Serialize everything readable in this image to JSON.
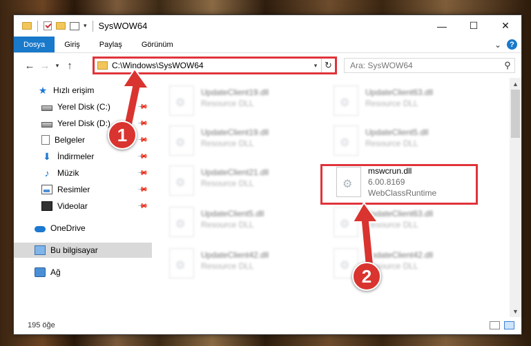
{
  "window": {
    "title": "SysWOW64",
    "controls": {
      "minimize": "—",
      "maximize": "☐",
      "close": "✕"
    }
  },
  "ribbon": {
    "tabs": [
      "Dosya",
      "Giriş",
      "Paylaş",
      "Görünüm"
    ],
    "help": "?"
  },
  "nav": {
    "back": "←",
    "forward": "→",
    "recent": "▾",
    "up": "↑",
    "address": "C:\\Windows\\SysWOW64",
    "search_placeholder": "Ara: SysWOW64"
  },
  "sidebar": {
    "quick_access": "Hızlı erişim",
    "items": [
      "Yerel Disk (C:)",
      "Yerel Disk (D:)",
      "Belgeler",
      "İndirmeler",
      "Müzik",
      "Resimler",
      "Videolar"
    ],
    "onedrive": "OneDrive",
    "this_pc": "Bu bilgisayar",
    "network": "Ağ"
  },
  "files": [
    {
      "name": "UpdateClient19.dll",
      "desc": "Resource DLL"
    },
    {
      "name": "UpdateClient63.dll",
      "desc": "Resource DLL"
    },
    {
      "name": "UpdateClient19.dll",
      "desc": "Resource DLL"
    },
    {
      "name": "UpdateClient5.dll",
      "desc": "Resource DLL"
    },
    {
      "name": "UpdateClient21.dll",
      "desc": "Resource DLL"
    },
    {
      "name": "mswcrun.dll",
      "version": "6.00.8169",
      "desc": "WebClassRuntime"
    },
    {
      "name": "UpdateClient5.dll",
      "desc": "Resource DLL"
    },
    {
      "name": "UpdateClient63.dll",
      "desc": "Resource DLL"
    },
    {
      "name": "UpdateClient42.dll",
      "desc": "Resource DLL"
    },
    {
      "name": "UpdateClient42.dll",
      "desc": "Resource DLL"
    }
  ],
  "status": {
    "count": "195 öğe"
  },
  "annotations": {
    "step1": "1",
    "step2": "2"
  }
}
